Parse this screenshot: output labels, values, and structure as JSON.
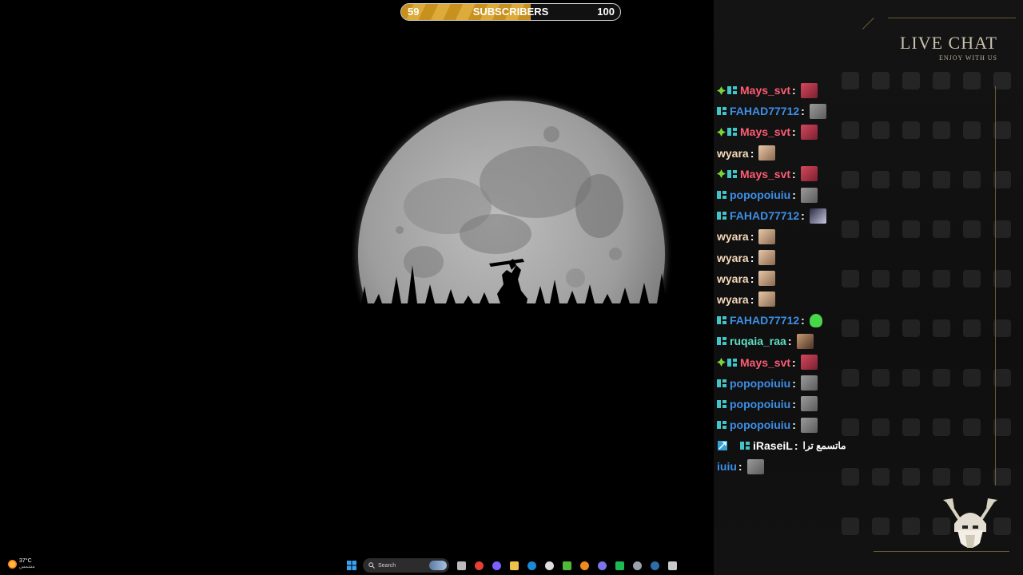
{
  "subscriber_goal": {
    "current": "59",
    "label": "SUBSCRIBERS",
    "goal": "100",
    "progress_fraction": 0.59,
    "fill_color": "#d3a233"
  },
  "chat_header": {
    "title": "LIVE CHAT",
    "subtitle": "ENJOY WITH US",
    "title_color": "#c9c1ad"
  },
  "chat": {
    "messages": [
      {
        "badges": [
          "plus",
          "prime"
        ],
        "user": "Mays_svt",
        "color": "#ff5c74",
        "emote": "red-avatar-emote",
        "text": ""
      },
      {
        "badges": [
          "prime"
        ],
        "user": "FAHAD77712",
        "color": "#3d8fe8",
        "emote": "gray-avatar-emote",
        "text": ""
      },
      {
        "badges": [
          "plus",
          "prime"
        ],
        "user": "Mays_svt",
        "color": "#ff5c74",
        "emote": "red-avatar-emote",
        "text": ""
      },
      {
        "badges": [],
        "user": "wyara",
        "color": "#f5d9ba",
        "emote": "pink-avatar-emote",
        "text": ""
      },
      {
        "badges": [
          "plus",
          "prime"
        ],
        "user": "Mays_svt",
        "color": "#ff5c74",
        "emote": "red-avatar-emote",
        "text": ""
      },
      {
        "badges": [
          "prime"
        ],
        "user": "popopoiuiu",
        "color": "#3d8fe8",
        "emote": "gray-avatar-emote",
        "text": ""
      },
      {
        "badges": [
          "prime"
        ],
        "user": "FAHAD77712",
        "color": "#3d8fe8",
        "emote": "dark-avatar-emote",
        "text": ""
      },
      {
        "badges": [],
        "user": "wyara",
        "color": "#f5d9ba",
        "emote": "pink-avatar-emote",
        "text": ""
      },
      {
        "badges": [],
        "user": "wyara",
        "color": "#f5d9ba",
        "emote": "pink-avatar-emote",
        "text": ""
      },
      {
        "badges": [],
        "user": "wyara",
        "color": "#f5d9ba",
        "emote": "pink-avatar-emote",
        "text": ""
      },
      {
        "badges": [],
        "user": "wyara",
        "color": "#f5d9ba",
        "emote": "pink-avatar-emote",
        "text": ""
      },
      {
        "badges": [
          "prime"
        ],
        "user": "FAHAD77712",
        "color": "#3d8fe8",
        "emote": "green-ghost-emote",
        "text": ""
      },
      {
        "badges": [
          "prime"
        ],
        "user": "ruqaia_raa",
        "color": "#5fdfc8",
        "emote": "photo-avatar-emote",
        "text": ""
      },
      {
        "badges": [
          "plus",
          "prime"
        ],
        "user": "Mays_svt",
        "color": "#ff5c74",
        "emote": "red-avatar-emote",
        "text": ""
      },
      {
        "badges": [
          "prime"
        ],
        "user": "popopoiuiu",
        "color": "#3d8fe8",
        "emote": "gray-avatar-emote",
        "text": ""
      },
      {
        "badges": [
          "prime"
        ],
        "user": "popopoiuiu",
        "color": "#3d8fe8",
        "emote": "gray-avatar-emote",
        "text": ""
      },
      {
        "badges": [
          "prime"
        ],
        "user": "popopoiuiu",
        "color": "#3d8fe8",
        "emote": "gray-avatar-emote",
        "text": ""
      },
      {
        "badges": [
          "mod",
          "prime"
        ],
        "user": "iRaseiL",
        "color": "#ffffff",
        "emote": "",
        "text": "ماتسمع ترا"
      },
      {
        "badges": [],
        "user": "iuiu",
        "color": "#3d8fe8",
        "emote": "gray-avatar-emote",
        "text": ""
      }
    ]
  },
  "taskbar": {
    "weather": {
      "temp": "37°C",
      "condition": "مشمس"
    },
    "search_placeholder": "Search",
    "apps": [
      "file-explorer-icon",
      "chrome-icon",
      "copilot-icon",
      "folder-icon",
      "edge-icon",
      "store-icon",
      "xbox-icon",
      "vlc-icon",
      "discord-icon",
      "spotify-icon",
      "terminal-icon",
      "steam-icon",
      "obs-icon"
    ]
  },
  "colors": {
    "prime_badge": "#41c5c8",
    "plus_badge": "#7bd33a",
    "mod_badge": "#36a3d6"
  }
}
